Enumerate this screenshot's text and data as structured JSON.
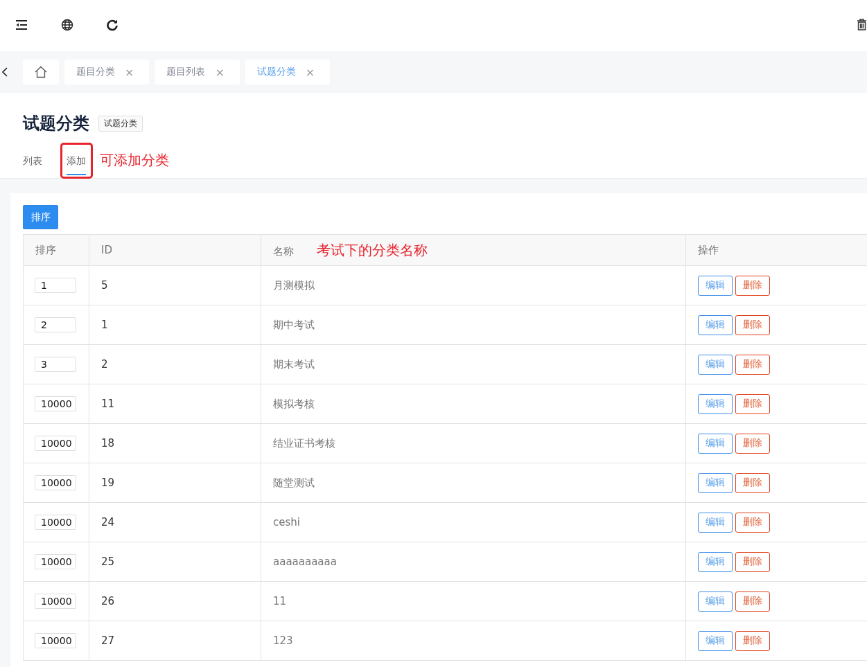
{
  "tag_bar": {
    "tags": [
      {
        "label": "题目分类",
        "selected": false,
        "close": "×"
      },
      {
        "label": "题目列表",
        "selected": false,
        "close": "×"
      },
      {
        "label": "试题分类",
        "selected": true,
        "close": "×"
      }
    ]
  },
  "page": {
    "title": "试题分类",
    "badge": "试题分类",
    "tabs": [
      {
        "label": "列表",
        "selected": false,
        "highlighted": false
      },
      {
        "label": "添加",
        "selected": true,
        "highlighted": true,
        "note": "可添加分类"
      }
    ]
  },
  "toolbar": {
    "sort_button": "排序"
  },
  "table": {
    "columns": [
      {
        "label": "排序"
      },
      {
        "label": "ID"
      },
      {
        "label": "名称",
        "note": "考试下的分类名称"
      },
      {
        "label": "操作"
      }
    ],
    "rows": [
      {
        "sort": "1",
        "id": "5",
        "name": "月测模拟",
        "actions": [
          {
            "label": "编辑",
            "kind": "edit"
          },
          {
            "label": "删除",
            "kind": "delete"
          }
        ]
      },
      {
        "sort": "2",
        "id": "1",
        "name": "期中考试",
        "actions": [
          {
            "label": "编辑",
            "kind": "edit"
          },
          {
            "label": "删除",
            "kind": "delete"
          }
        ]
      },
      {
        "sort": "3",
        "id": "2",
        "name": "期末考试",
        "actions": [
          {
            "label": "编辑",
            "kind": "edit"
          },
          {
            "label": "删除",
            "kind": "delete"
          }
        ]
      },
      {
        "sort": "10000",
        "id": "11",
        "name": "模拟考核",
        "actions": [
          {
            "label": "编辑",
            "kind": "edit"
          },
          {
            "label": "删除",
            "kind": "delete"
          }
        ]
      },
      {
        "sort": "10000",
        "id": "18",
        "name": "结业证书考核",
        "actions": [
          {
            "label": "编辑",
            "kind": "edit"
          },
          {
            "label": "删除",
            "kind": "delete"
          }
        ]
      },
      {
        "sort": "10000",
        "id": "19",
        "name": "随堂测试",
        "actions": [
          {
            "label": "编辑",
            "kind": "edit"
          },
          {
            "label": "删除",
            "kind": "delete"
          }
        ]
      },
      {
        "sort": "10000",
        "id": "24",
        "name": "ceshi",
        "actions": [
          {
            "label": "编辑",
            "kind": "edit"
          },
          {
            "label": "删除",
            "kind": "delete"
          }
        ]
      },
      {
        "sort": "10000",
        "id": "25",
        "name": "aaaaaaaaaa",
        "actions": [
          {
            "label": "编辑",
            "kind": "edit"
          },
          {
            "label": "删除",
            "kind": "delete"
          }
        ]
      },
      {
        "sort": "10000",
        "id": "26",
        "name": "11",
        "actions": [
          {
            "label": "编辑",
            "kind": "edit"
          },
          {
            "label": "删除",
            "kind": "delete"
          }
        ]
      },
      {
        "sort": "10000",
        "id": "27",
        "name": "123",
        "actions": [
          {
            "label": "编辑",
            "kind": "edit"
          },
          {
            "label": "删除",
            "kind": "delete"
          }
        ]
      }
    ]
  }
}
